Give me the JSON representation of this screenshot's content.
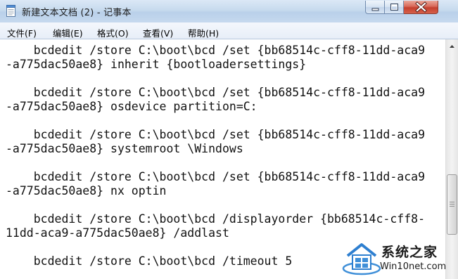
{
  "window": {
    "title": "新建文本文档 (2) - 记事本"
  },
  "menu": {
    "items": [
      {
        "label": "文件(F)"
      },
      {
        "label": "编辑(E)"
      },
      {
        "label": "格式(O)"
      },
      {
        "label": "查看(V)"
      },
      {
        "label": "帮助(H)"
      }
    ]
  },
  "editor": {
    "lines": [
      "    bcdedit /store C:\\boot\\bcd /set {bb68514c-cff8-11dd-aca9",
      "-a775dac50ae8} inherit {bootloadersettings}",
      "",
      "    bcdedit /store C:\\boot\\bcd /set {bb68514c-cff8-11dd-aca9",
      "-a775dac50ae8} osdevice partition=C:",
      "",
      "    bcdedit /store C:\\boot\\bcd /set {bb68514c-cff8-11dd-aca9",
      "-a775dac50ae8} systemroot \\Windows",
      "",
      "    bcdedit /store C:\\boot\\bcd /set {bb68514c-cff8-11dd-aca9",
      "-a775dac50ae8} nx optin",
      "",
      "    bcdedit /store C:\\boot\\bcd /displayorder {bb68514c-cff8-",
      "11dd-aca9-a775dac50ae8} /addlast",
      "",
      "    bcdedit /store C:\\boot\\bcd /timeout 5"
    ]
  },
  "watermark": {
    "name": "系统之家",
    "url": "Win10net.com"
  },
  "icons": {
    "app": "notepad-icon",
    "minimize": "minimize-icon",
    "maximize": "maximize-icon",
    "close": "close-icon",
    "scroll_up": "scroll-up-arrow-icon",
    "watermark_logo": "house-logo-icon"
  },
  "colors": {
    "titlebar": "#c7daee",
    "close_button": "#c4402e",
    "editor_background": "#ffffff",
    "text": "#111111"
  }
}
